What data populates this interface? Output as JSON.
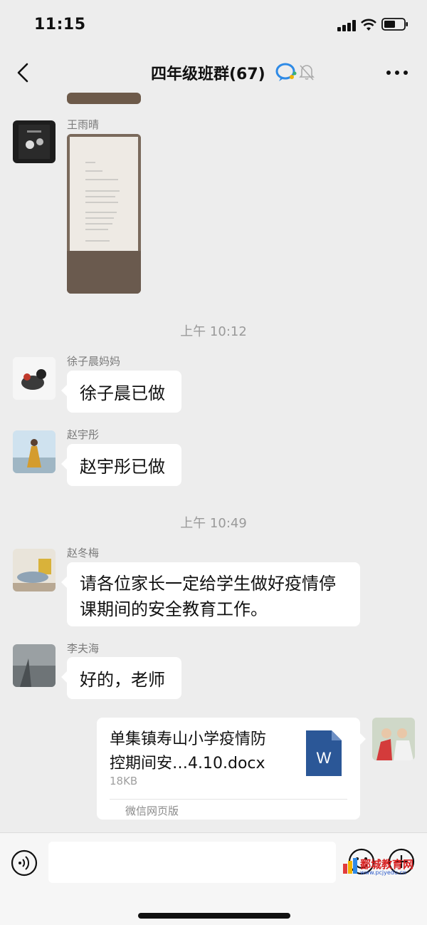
{
  "status_bar": {
    "time": "11:15"
  },
  "nav": {
    "title": "四年级班群(67)"
  },
  "messages": [
    {
      "sender": "王雨晴",
      "type": "image"
    },
    {
      "timestamp": "上午 10:12"
    },
    {
      "sender": "徐子晨妈妈",
      "text": "徐子晨已做"
    },
    {
      "sender": "赵宇彤",
      "text": "赵宇彤已做"
    },
    {
      "timestamp": "上午 10:49"
    },
    {
      "sender": "赵冬梅",
      "text_lines": [
        "请各位家长一定给学生做好疫情停",
        "课期间的安全教育工作。"
      ]
    },
    {
      "sender": "李夫海",
      "text": "好的，老师"
    }
  ],
  "file_message": {
    "name_lines": [
      "单集镇寿山小学疫情防",
      "控期间安…4.10.docx"
    ],
    "size": "18KB",
    "source": "微信网页版",
    "icon_letter": "W"
  },
  "watermark": {
    "text": "鄱城教育网",
    "url": "www.pcjyedu.cn"
  },
  "colors": {
    "background": "#ededed",
    "bubble": "#ffffff",
    "word_blue": "#2b5797"
  }
}
